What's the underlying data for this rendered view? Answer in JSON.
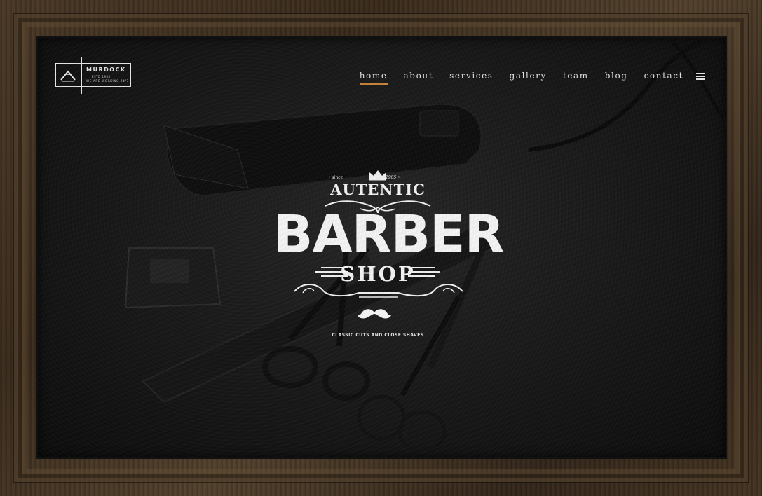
{
  "logo": {
    "name": "MURDOCK",
    "est": "ESTD 1985",
    "tagline": "WE ARE WORKING 24/7"
  },
  "nav": {
    "items": [
      {
        "label": "home",
        "active": true
      },
      {
        "label": "about",
        "active": false
      },
      {
        "label": "services",
        "active": false
      },
      {
        "label": "gallery",
        "active": false
      },
      {
        "label": "team",
        "active": false
      },
      {
        "label": "blog",
        "active": false
      },
      {
        "label": "contact",
        "active": false
      }
    ],
    "menu_icon": "hamburger-icon"
  },
  "hero": {
    "since_left": "• since",
    "since_right": "1985 •",
    "autentic": "AUTENTIC",
    "barber": "BARBER",
    "shop": "SHOP",
    "tagline": "CLASSIC CUTS AND CLOSE SHAVES"
  },
  "colors": {
    "accent": "#c8843a",
    "text": "#e6e6e6",
    "frame": "#4a3826"
  }
}
